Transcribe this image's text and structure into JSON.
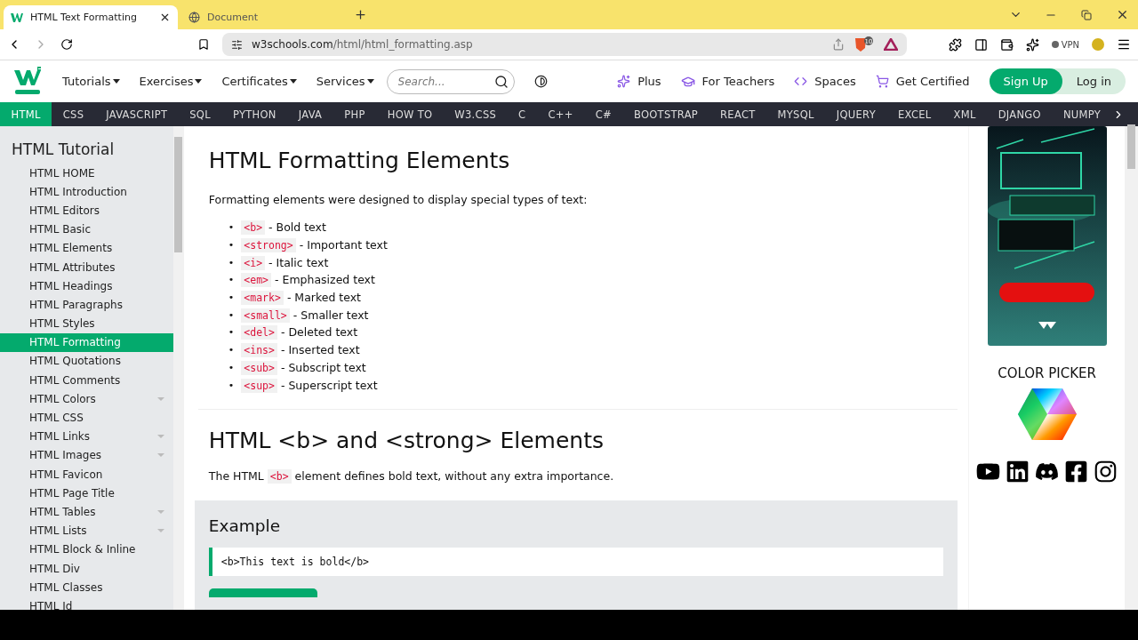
{
  "browser": {
    "tabs": [
      {
        "title": "HTML Text Formatting",
        "selected": true
      },
      {
        "title": "Document",
        "selected": false
      }
    ],
    "address": {
      "host": "w3schools.com",
      "path": "/html/html_formatting.asp"
    },
    "shield_count": "10",
    "vpn": "VPN"
  },
  "site_nav": {
    "menus": [
      "Tutorials",
      "Exercises",
      "Certificates",
      "Services"
    ],
    "search": {
      "placeholder": "Search..."
    },
    "links": [
      {
        "label": "Plus"
      },
      {
        "label": "For Teachers"
      },
      {
        "label": "Spaces"
      },
      {
        "label": "Get Certified"
      }
    ],
    "sign_up": "Sign Up",
    "log_in": "Log in"
  },
  "topics": [
    {
      "label": "HTML",
      "selected": true
    },
    {
      "label": "CSS",
      "selected": false
    },
    {
      "label": "JAVASCRIPT",
      "selected": false
    },
    {
      "label": "SQL",
      "selected": false
    },
    {
      "label": "PYTHON",
      "selected": false
    },
    {
      "label": "JAVA",
      "selected": false
    },
    {
      "label": "PHP",
      "selected": false
    },
    {
      "label": "HOW TO",
      "selected": false
    },
    {
      "label": "W3.CSS",
      "selected": false
    },
    {
      "label": "C",
      "selected": false
    },
    {
      "label": "C++",
      "selected": false
    },
    {
      "label": "C#",
      "selected": false
    },
    {
      "label": "BOOTSTRAP",
      "selected": false
    },
    {
      "label": "REACT",
      "selected": false
    },
    {
      "label": "MYSQL",
      "selected": false
    },
    {
      "label": "JQUERY",
      "selected": false
    },
    {
      "label": "EXCEL",
      "selected": false
    },
    {
      "label": "XML",
      "selected": false
    },
    {
      "label": "DJANGO",
      "selected": false
    },
    {
      "label": "NUMPY",
      "selected": false
    }
  ],
  "sidebar": {
    "title": "HTML Tutorial",
    "items": [
      {
        "label": "HTML HOME",
        "selected": false,
        "collapsible": false
      },
      {
        "label": "HTML Introduction",
        "selected": false,
        "collapsible": false
      },
      {
        "label": "HTML Editors",
        "selected": false,
        "collapsible": false
      },
      {
        "label": "HTML Basic",
        "selected": false,
        "collapsible": false
      },
      {
        "label": "HTML Elements",
        "selected": false,
        "collapsible": false
      },
      {
        "label": "HTML Attributes",
        "selected": false,
        "collapsible": false
      },
      {
        "label": "HTML Headings",
        "selected": false,
        "collapsible": false
      },
      {
        "label": "HTML Paragraphs",
        "selected": false,
        "collapsible": false
      },
      {
        "label": "HTML Styles",
        "selected": false,
        "collapsible": false
      },
      {
        "label": "HTML Formatting",
        "selected": true,
        "collapsible": false
      },
      {
        "label": "HTML Quotations",
        "selected": false,
        "collapsible": false
      },
      {
        "label": "HTML Comments",
        "selected": false,
        "collapsible": false
      },
      {
        "label": "HTML Colors",
        "selected": false,
        "collapsible": true
      },
      {
        "label": "HTML CSS",
        "selected": false,
        "collapsible": false
      },
      {
        "label": "HTML Links",
        "selected": false,
        "collapsible": true
      },
      {
        "label": "HTML Images",
        "selected": false,
        "collapsible": true
      },
      {
        "label": "HTML Favicon",
        "selected": false,
        "collapsible": false
      },
      {
        "label": "HTML Page Title",
        "selected": false,
        "collapsible": false
      },
      {
        "label": "HTML Tables",
        "selected": false,
        "collapsible": true
      },
      {
        "label": "HTML Lists",
        "selected": false,
        "collapsible": true
      },
      {
        "label": "HTML Block & Inline",
        "selected": false,
        "collapsible": false
      },
      {
        "label": "HTML Div",
        "selected": false,
        "collapsible": false
      },
      {
        "label": "HTML Classes",
        "selected": false,
        "collapsible": false
      },
      {
        "label": "HTML Id",
        "selected": false,
        "collapsible": false
      }
    ]
  },
  "content": {
    "heading": "HTML Formatting Elements",
    "intro": "Formatting elements were designed to display special types of text:",
    "bullet": "•",
    "elements": [
      {
        "tag": "<b>",
        "text": "- Bold text"
      },
      {
        "tag": "<strong>",
        "text": "- Important text"
      },
      {
        "tag": "<i>",
        "text": "- Italic text"
      },
      {
        "tag": "<em>",
        "text": "- Emphasized text"
      },
      {
        "tag": "<mark>",
        "text": "- Marked text"
      },
      {
        "tag": "<small>",
        "text": "- Smaller text"
      },
      {
        "tag": "<del>",
        "text": "- Deleted text"
      },
      {
        "tag": "<ins>",
        "text": "- Inserted text"
      },
      {
        "tag": "<sub>",
        "text": "- Subscript text"
      },
      {
        "tag": "<sup>",
        "text": "- Superscript text"
      }
    ],
    "section_heading": "HTML <b> and <strong> Elements",
    "section_text": {
      "before": "The HTML",
      "tag": "<b>",
      "after": "element defines bold text, without any extra importance."
    },
    "example": {
      "title": "Example",
      "code": "<b>This text is bold</b>"
    }
  },
  "right_panel": {
    "color_picker": "COLOR PICKER"
  }
}
